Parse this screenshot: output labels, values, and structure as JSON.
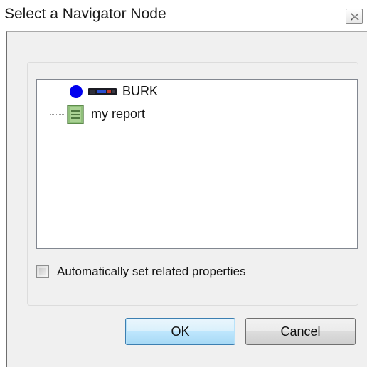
{
  "window": {
    "title": "Select a Navigator Node"
  },
  "tree": {
    "nodes": [
      {
        "label": "BURK",
        "status_color": "#0000ee",
        "icon": "device-icon"
      },
      {
        "label": "my report",
        "icon": "report-icon"
      }
    ]
  },
  "options": {
    "auto_set_label": "Automatically set related properties",
    "auto_set_checked": false
  },
  "buttons": {
    "ok_label": "OK",
    "cancel_label": "Cancel"
  }
}
